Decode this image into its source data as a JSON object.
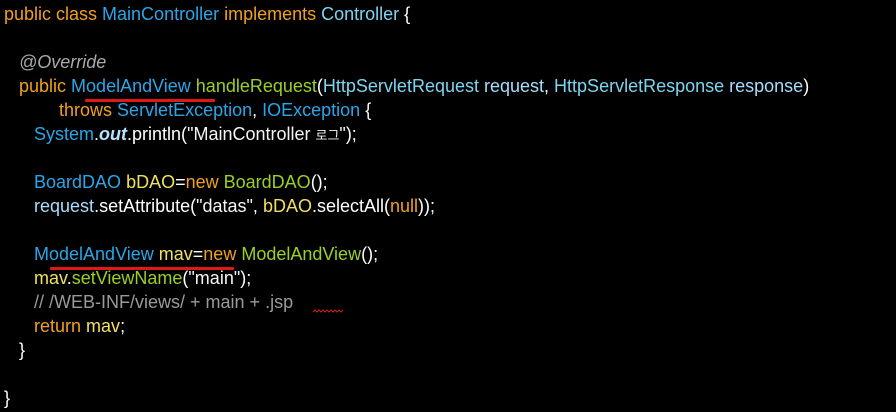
{
  "editor": {
    "lines": [
      {
        "tokens": [
          {
            "t": "public class ",
            "c": "kw"
          },
          {
            "t": "MainController",
            "c": "cls"
          },
          {
            "t": " implements ",
            "c": "kw"
          },
          {
            "t": "Controller",
            "c": "cls-light"
          },
          {
            "t": " {",
            "c": "plain"
          }
        ]
      },
      {
        "tokens": []
      },
      {
        "tokens": [
          {
            "t": "   ",
            "c": "plain"
          },
          {
            "t": "@Override",
            "c": "annot"
          }
        ]
      },
      {
        "tokens": [
          {
            "t": "   ",
            "c": "plain"
          },
          {
            "t": "public ",
            "c": "kw"
          },
          {
            "t": "ModelAndView",
            "c": "cls"
          },
          {
            "t": " handleRequest",
            "c": "method"
          },
          {
            "t": "(",
            "c": "plain"
          },
          {
            "t": "HttpServletRequest",
            "c": "cls-light"
          },
          {
            "t": " request",
            "c": "ident"
          },
          {
            "t": ", ",
            "c": "plain"
          },
          {
            "t": "HttpServletResponse",
            "c": "cls-light"
          },
          {
            "t": " response",
            "c": "ident"
          },
          {
            "t": ")",
            "c": "plain"
          }
        ]
      },
      {
        "tokens": [
          {
            "t": "           ",
            "c": "plain"
          },
          {
            "t": "throws ",
            "c": "kw"
          },
          {
            "t": "ServletException",
            "c": "cls"
          },
          {
            "t": ", ",
            "c": "plain"
          },
          {
            "t": "IOException",
            "c": "cls"
          },
          {
            "t": " {",
            "c": "plain"
          }
        ]
      },
      {
        "tokens": [
          {
            "t": "      ",
            "c": "plain"
          },
          {
            "t": "System",
            "c": "cls"
          },
          {
            "t": ".",
            "c": "plain"
          },
          {
            "t": "out",
            "c": "field"
          },
          {
            "t": ".println(",
            "c": "plain"
          },
          {
            "t": "\"MainController ",
            "c": "str"
          },
          {
            "t": "로그",
            "c": "str ko"
          },
          {
            "t": "\"",
            "c": "str"
          },
          {
            "t": ");",
            "c": "plain"
          }
        ]
      },
      {
        "tokens": []
      },
      {
        "tokens": [
          {
            "t": "      ",
            "c": "plain"
          },
          {
            "t": "BoardDAO",
            "c": "cls"
          },
          {
            "t": " bDAO",
            "c": "var"
          },
          {
            "t": "=",
            "c": "plain"
          },
          {
            "t": "new ",
            "c": "kw"
          },
          {
            "t": "BoardDAO",
            "c": "method"
          },
          {
            "t": "();",
            "c": "plain"
          }
        ]
      },
      {
        "tokens": [
          {
            "t": "      ",
            "c": "plain"
          },
          {
            "t": "request",
            "c": "ident"
          },
          {
            "t": ".setAttribute(",
            "c": "plain"
          },
          {
            "t": "\"datas\"",
            "c": "str"
          },
          {
            "t": ", ",
            "c": "plain"
          },
          {
            "t": "bDAO",
            "c": "var"
          },
          {
            "t": ".selectAll(",
            "c": "plain"
          },
          {
            "t": "null",
            "c": "kw"
          },
          {
            "t": "));",
            "c": "plain"
          }
        ]
      },
      {
        "tokens": []
      },
      {
        "tokens": [
          {
            "t": "      ",
            "c": "plain"
          },
          {
            "t": "ModelAndView",
            "c": "cls"
          },
          {
            "t": " mav",
            "c": "var"
          },
          {
            "t": "=",
            "c": "plain"
          },
          {
            "t": "new ",
            "c": "kw"
          },
          {
            "t": "ModelAndView",
            "c": "method"
          },
          {
            "t": "();",
            "c": "plain"
          }
        ]
      },
      {
        "tokens": [
          {
            "t": "      ",
            "c": "plain"
          },
          {
            "t": "mav",
            "c": "var"
          },
          {
            "t": ".",
            "c": "plain"
          },
          {
            "t": "setViewName",
            "c": "method"
          },
          {
            "t": "(",
            "c": "plain"
          },
          {
            "t": "\"main\"",
            "c": "str"
          },
          {
            "t": ");",
            "c": "plain"
          }
        ]
      },
      {
        "tokens": [
          {
            "t": "      ",
            "c": "plain"
          },
          {
            "t": "// /WEB-INF/views/ + main + .jsp",
            "c": "comment"
          }
        ]
      },
      {
        "tokens": [
          {
            "t": "      ",
            "c": "plain"
          },
          {
            "t": "return ",
            "c": "kw"
          },
          {
            "t": "mav",
            "c": "var"
          },
          {
            "t": ";",
            "c": "plain"
          }
        ]
      },
      {
        "tokens": [
          {
            "t": "   }",
            "c": "plain"
          }
        ]
      },
      {
        "tokens": []
      },
      {
        "tokens": [
          {
            "t": "}",
            "c": "plain"
          }
        ]
      }
    ]
  },
  "colors": {
    "background": "#000000",
    "keyword": "#f0a020",
    "class": "#2aa6e8",
    "method": "#9ad026",
    "variable": "#f0e060",
    "underline": "#e01818"
  }
}
